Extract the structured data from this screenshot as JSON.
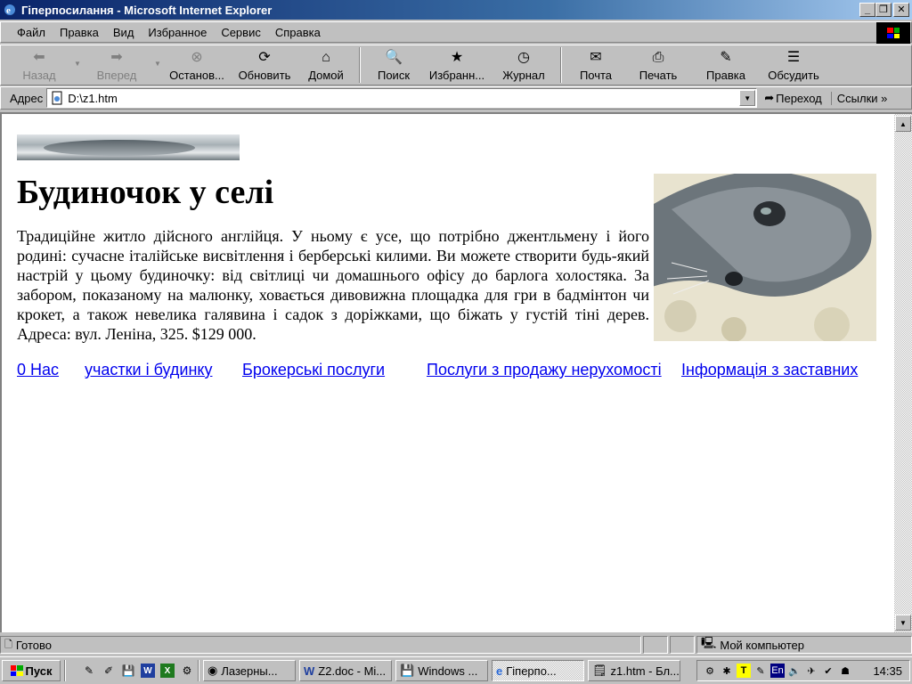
{
  "window": {
    "title": "Гіперпосилання - Microsoft Internet Explorer"
  },
  "menu": [
    "Файл",
    "Правка",
    "Вид",
    "Избранное",
    "Сервис",
    "Справка"
  ],
  "toolbar": {
    "back": "Назад",
    "forward": "Вперед",
    "stop": "Останов...",
    "refresh": "Обновить",
    "home": "Домой",
    "search": "Поиск",
    "favorites": "Избранн...",
    "history": "Журнал",
    "mail": "Почта",
    "print": "Печать",
    "edit": "Правка",
    "discuss": "Обсудить"
  },
  "address": {
    "label": "Адрес",
    "value": "D:\\z1.htm",
    "go": "Переход",
    "links": "Ссылки"
  },
  "doc": {
    "heading": "Будиночок у селі",
    "paragraph": "Традиційне житло дійсного англійця. У ньому є усе, що потрібно джентльмену і його родині: сучасне італійське висвітлення і берберські килими. Ви можете створити будь-який настрій у цьому будиночку: від світлиці чи домашнього офісу до барлога холостяка. За забором, показаному на малюнку, ховається дивовижна площадка для гри в бадмінтон чи крокет, а також невелика галявина і садок з доріжками, що біжать у густій тіні дерев. Адреса: вул. Леніна, 325. $129 000.",
    "links": [
      "0 Нас",
      "участки і будинку",
      "Брокерські послуги",
      "Послуги з продажу нерухомості",
      "Інформація з заставних"
    ]
  },
  "status": {
    "text": "Готово",
    "zone": "Мой компьютер"
  },
  "taskbar": {
    "start": "Пуск",
    "tasks": [
      "Лазерны...",
      "Z2.doc - Mi...",
      "Windows ...",
      "Гіперпо...",
      "z1.htm - Бл..."
    ],
    "lang": "En",
    "clock": "14:35"
  }
}
